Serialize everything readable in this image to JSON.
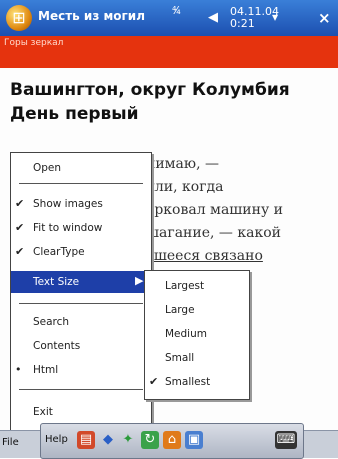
{
  "titlebar": {
    "app_title": "Месть из могил",
    "signal": "⁴⁄₄",
    "date": "04.11.04",
    "time": "0:21",
    "close": "×"
  },
  "strip": {
    "text": "Горы зеркал"
  },
  "document": {
    "heading_line1": "Вашингтон, округ Колумбия",
    "heading_line2": "День первый",
    "body_lines": [
      "нимаю, —",
      "лли, когда",
      "арковал машину и",
      "шагание, — какой",
      "вшееся связано"
    ]
  },
  "menu": {
    "items": [
      {
        "label": "Open",
        "checked": false
      },
      {
        "label": "Show images",
        "checked": true
      },
      {
        "label": "Fit to window",
        "checked": true
      },
      {
        "label": "ClearType",
        "checked": true
      },
      {
        "label": "Text Size",
        "checked": false,
        "submenu": true,
        "selected": true
      },
      {
        "label": "Search",
        "checked": false
      },
      {
        "label": "Contents",
        "checked": false
      },
      {
        "label": "Html",
        "checked": false,
        "bullet": true
      },
      {
        "label": "Exit",
        "checked": false
      }
    ],
    "check_glyph": "✔",
    "bullet_glyph": "•",
    "submenu_arrow": "▶"
  },
  "submenu": {
    "items": [
      {
        "label": "Largest",
        "checked": false
      },
      {
        "label": "Large",
        "checked": false
      },
      {
        "label": "Medium",
        "checked": false
      },
      {
        "label": "Small",
        "checked": false
      },
      {
        "label": "Smallest",
        "checked": true
      }
    ]
  },
  "bottombar": {
    "file_label": "File",
    "help_label": "Help"
  },
  "colors": {
    "titlebar": "#2a62c6",
    "strip": "#e5330e",
    "menu_selected": "#1e3fa8"
  }
}
